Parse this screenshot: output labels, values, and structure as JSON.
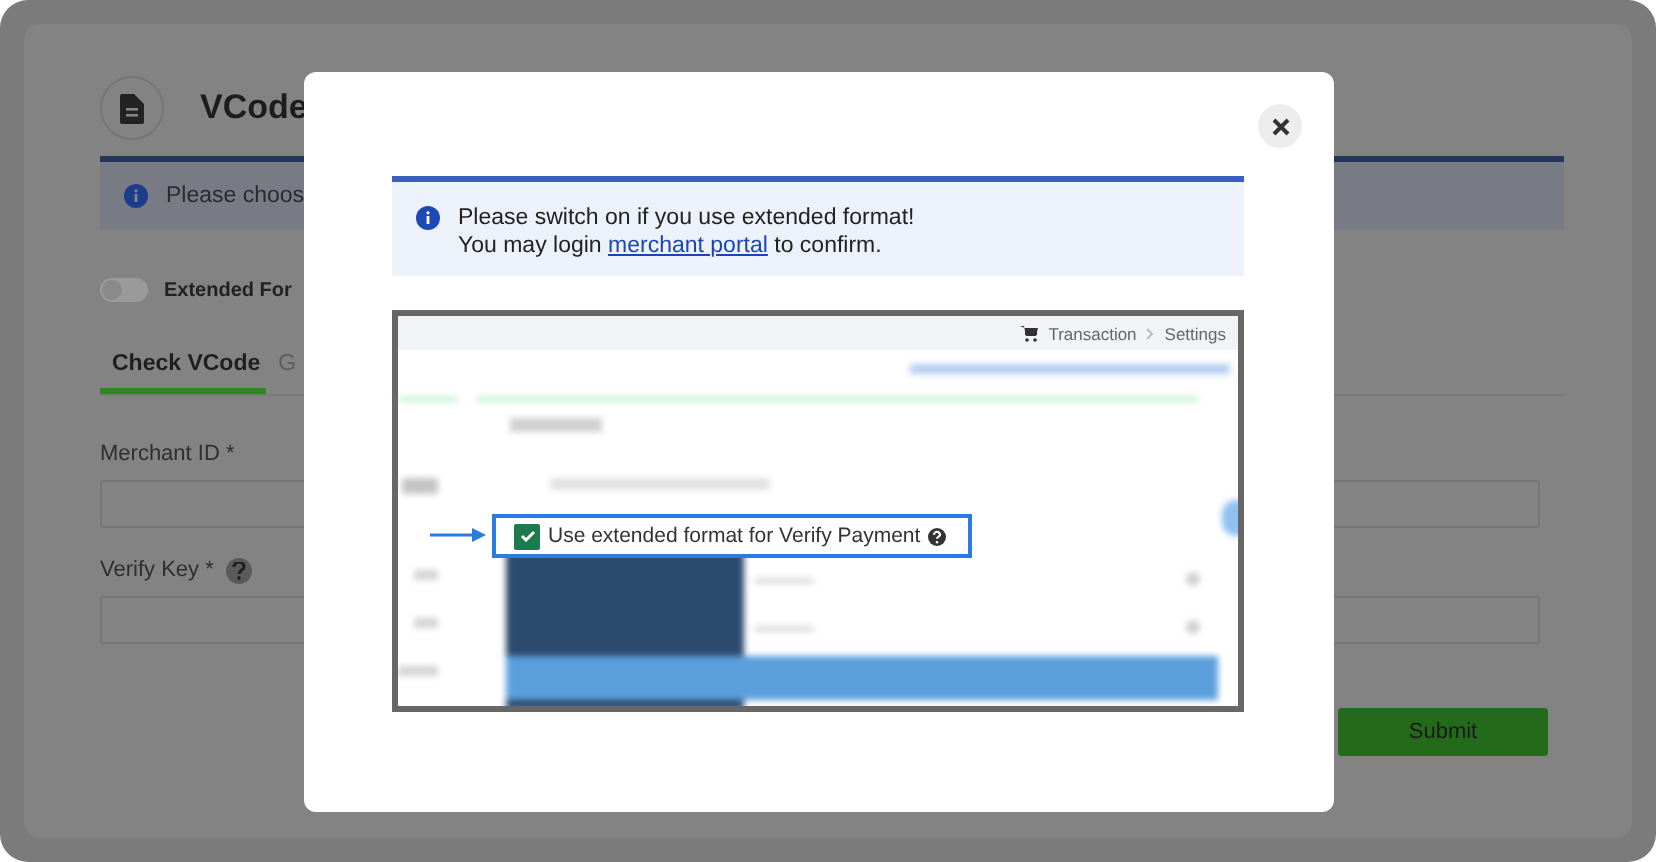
{
  "page": {
    "title": "VCode",
    "notice": "Please choos",
    "toggle": {
      "label": "Extended For",
      "on": false
    },
    "tabs": [
      {
        "label": "Check VCode",
        "selected": true
      },
      {
        "label": "G",
        "selected": false
      }
    ],
    "fields": [
      {
        "label": "Merchant ID *",
        "help": false
      },
      {
        "label": "Verify Key *",
        "help": true
      }
    ],
    "submit": "Submit"
  },
  "modal": {
    "notice": {
      "line1": "Please switch on if you use extended format!",
      "line2_before": "You may login",
      "link": "merchant portal",
      "line2_after": "to confirm."
    },
    "screenshot": {
      "breadcrumb": [
        "Transaction",
        "Settings"
      ],
      "checkbox": {
        "label": "Use extended format for Verify Payment",
        "checked": true
      }
    }
  }
}
